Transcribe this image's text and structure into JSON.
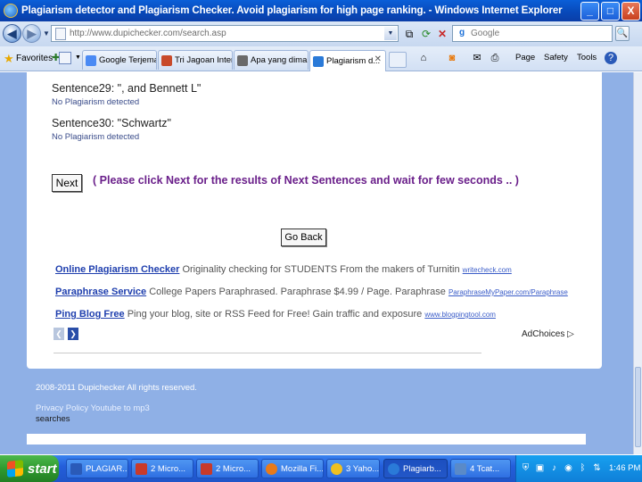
{
  "window": {
    "title": "Plagiarism detector and Plagiarism Checker. Avoid plagiarism for high page ranking. - Windows Internet Explorer",
    "minimize": "_",
    "maximize": "□",
    "close": "X"
  },
  "addressbar": {
    "url": "http://www.dupichecker.com/search.asp",
    "search_placeholder": "Google",
    "back_icon": "back-arrow-icon",
    "forward_icon": "forward-arrow-icon"
  },
  "favorites": {
    "label": "Favorites",
    "tabs": [
      {
        "label": "Google Terjemah...",
        "color": "#4a8af4"
      },
      {
        "label": "Tri Jagoan Internet",
        "color": "#c84a2a"
      },
      {
        "label": "Apa yang dimaks...",
        "color": "#6a6a6a"
      },
      {
        "label": "Plagiarism d...",
        "color": "#2a7ad8",
        "active": true
      }
    ],
    "commands": [
      "Page",
      "Safety",
      "Tools"
    ]
  },
  "page": {
    "sentences": [
      {
        "text": "Sentence29: \", and Bennett L\"",
        "result": "No Plagiarism detected"
      },
      {
        "text": "Sentence30: \"Schwartz\"",
        "result": "No Plagiarism detected"
      }
    ],
    "next_button": "Next",
    "next_message": "( Please click Next for the results of Next Sentences and wait for few seconds .. )",
    "goback_button": "Go Back",
    "ads": [
      {
        "title": "Online Plagiarism Checker",
        "desc": "Originality checking for STUDENTS From the makers of Turnitin",
        "url": "writecheck.com"
      },
      {
        "title": "Paraphrase Service",
        "desc": "College Papers Paraphrased. Paraphrase $4.99 / Page. Paraphrase",
        "url": "ParaphraseMyPaper.com/Paraphrase"
      },
      {
        "title": "Ping Blog Free",
        "desc": "Ping your blog, site or RSS Feed for Free! Gain traffic and exposure",
        "url": "www.blogpingtool.com"
      }
    ],
    "adchoices": "AdChoices",
    "footer_copy": "2008-2011 Dupichecker All rights reserved.",
    "footer_links": "Privacy Policy Youtube to mp3",
    "footer_sub": "searches"
  },
  "taskbar": {
    "start": "start",
    "tasks": [
      {
        "label": "PLAGIAR...",
        "color": "#2a5ab8"
      },
      {
        "label": "2 Micro...",
        "color": "#c83a2a"
      },
      {
        "label": "2 Micro...",
        "color": "#c83a2a"
      },
      {
        "label": "Mozilla Fi...",
        "color": "#e87a1a"
      },
      {
        "label": "3 Yaho...",
        "color": "#f0c020"
      },
      {
        "label": "Plagiarb...",
        "color": "#2a7ad8",
        "active": true
      },
      {
        "label": "4 Tcat...",
        "color": "#5a8ac8"
      }
    ],
    "clock": "1:46 PM"
  }
}
